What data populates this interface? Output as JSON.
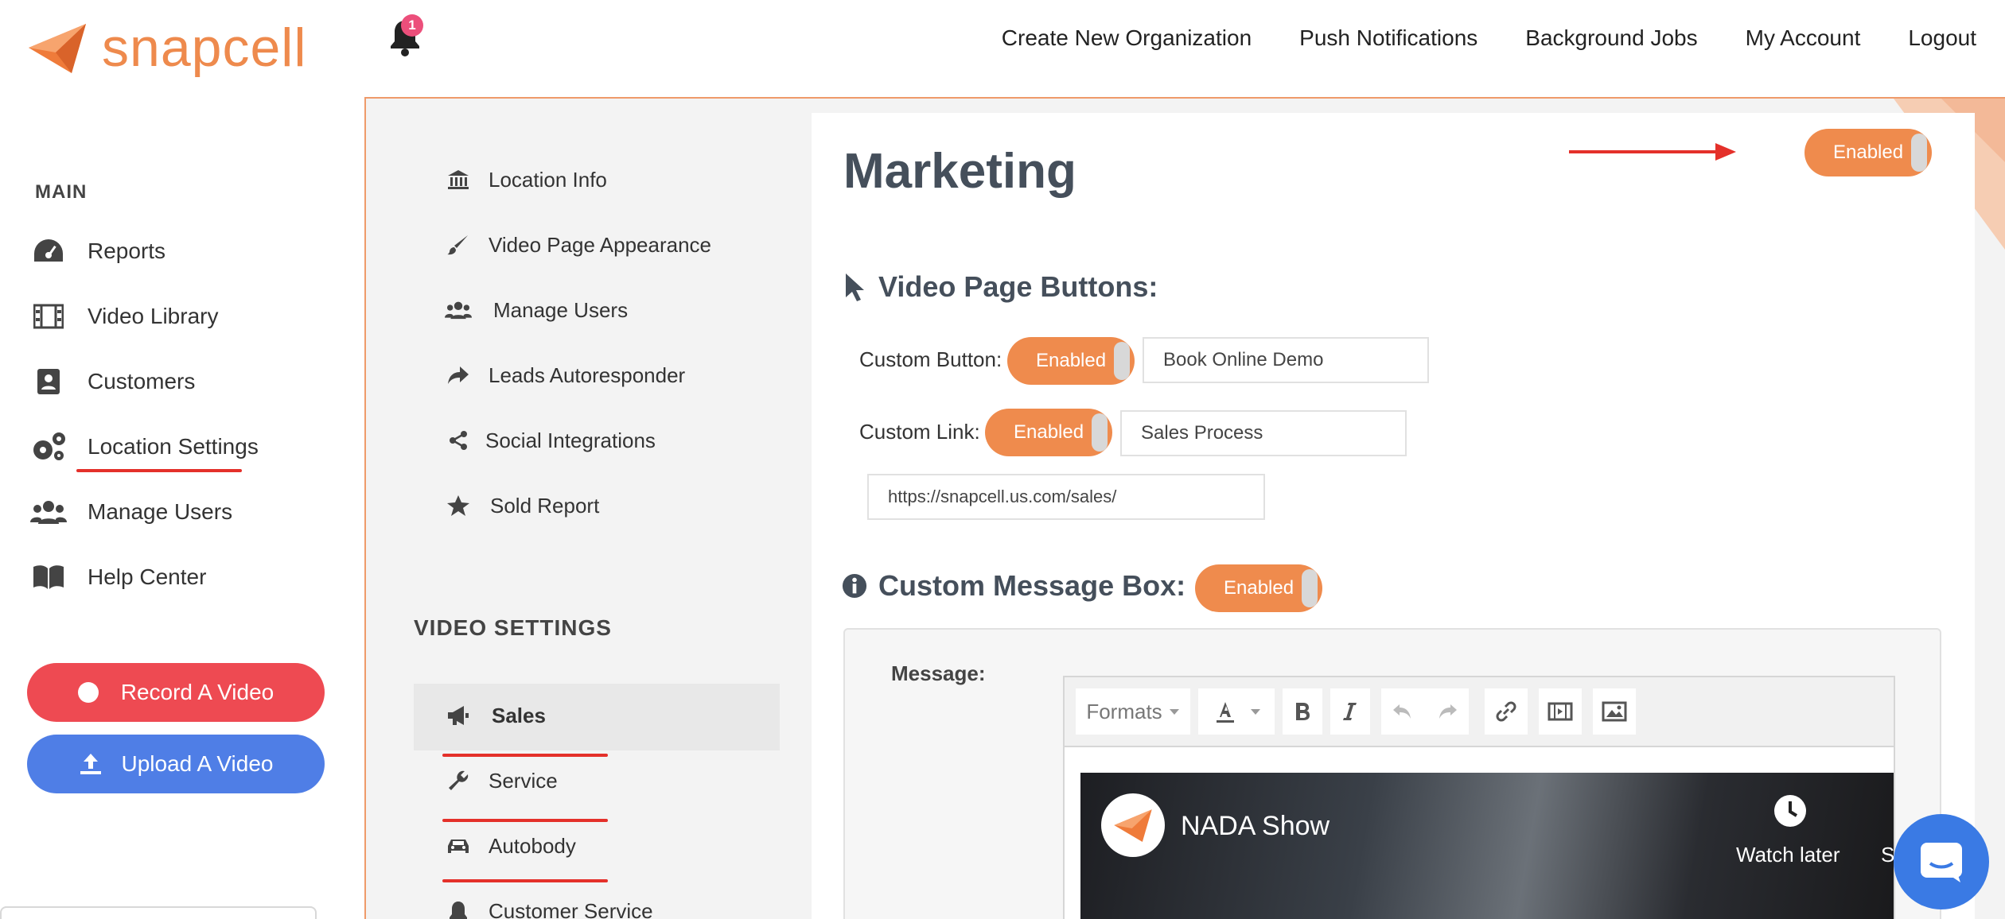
{
  "brand": {
    "name": "snapcell",
    "color": "#ee8a4d"
  },
  "notifications": {
    "badge_count": "1"
  },
  "topnav": {
    "items": [
      "Create New Organization",
      "Push Notifications",
      "Background Jobs",
      "My Account",
      "Logout"
    ]
  },
  "sidebar": {
    "section_label": "MAIN",
    "items": [
      {
        "label": "Reports",
        "icon": "gauge-icon"
      },
      {
        "label": "Video Library",
        "icon": "film-icon"
      },
      {
        "label": "Customers",
        "icon": "contact-card-icon"
      },
      {
        "label": "Location Settings",
        "icon": "gears-icon"
      },
      {
        "label": "Manage Users",
        "icon": "users-icon"
      },
      {
        "label": "Help Center",
        "icon": "book-icon"
      }
    ],
    "record_button": "Record A Video",
    "upload_button": "Upload A Video"
  },
  "submenu": {
    "items": [
      {
        "label": "Location Info",
        "icon": "bank-icon"
      },
      {
        "label": "Video Page Appearance",
        "icon": "brush-icon"
      },
      {
        "label": "Manage Users",
        "icon": "users-icon"
      },
      {
        "label": "Leads Autoresponder",
        "icon": "share-arrow-icon"
      },
      {
        "label": "Social Integrations",
        "icon": "share-nodes-icon"
      },
      {
        "label": "Sold Report",
        "icon": "star-icon"
      }
    ],
    "video_settings_title": "VIDEO SETTINGS",
    "video_settings": [
      {
        "label": "Sales",
        "icon": "megaphone-icon"
      },
      {
        "label": "Service",
        "icon": "wrench-icon"
      },
      {
        "label": "Autobody",
        "icon": "car-icon"
      },
      {
        "label": "Customer Service",
        "icon": "bell-icon"
      }
    ]
  },
  "panel": {
    "title": "Marketing",
    "enabled_label": "Enabled",
    "video_page_buttons_title": "Video Page Buttons:",
    "custom_button_label": "Custom Button:",
    "custom_button_value": "Book Online Demo",
    "custom_link_label": "Custom Link:",
    "custom_link_value": "Sales Process",
    "custom_link_url": "https://snapcell.us.com/sales/",
    "custom_message_title": "Custom Message Box:",
    "message_label": "Message:",
    "editor": {
      "formats_label": "Formats"
    },
    "video": {
      "title": "NADA Show",
      "watch_later": "Watch later",
      "share_cut": "S"
    }
  },
  "colors": {
    "accent": "#ef8b4d",
    "record": "#ee4a52",
    "upload": "#4f7ee6",
    "highlight": "#e4302a"
  }
}
